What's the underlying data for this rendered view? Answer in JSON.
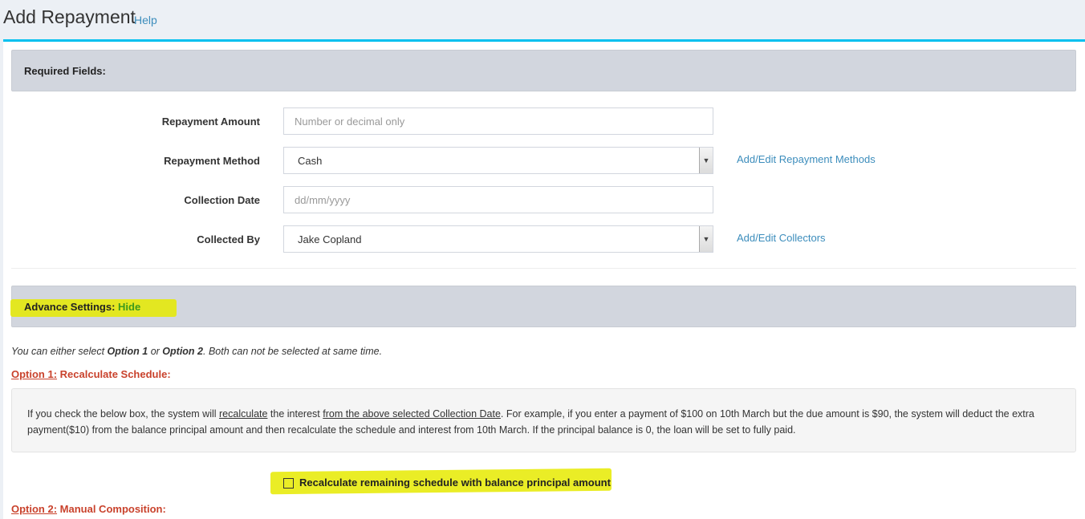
{
  "header": {
    "title": "Add Repayment",
    "help_label": "Help"
  },
  "required_section": {
    "title": "Required Fields:"
  },
  "form": {
    "repayment_amount": {
      "label": "Repayment Amount",
      "value": "",
      "placeholder": "Number or decimal only"
    },
    "repayment_method": {
      "label": "Repayment Method",
      "selected": "Cash",
      "link": "Add/Edit Repayment Methods"
    },
    "collection_date": {
      "label": "Collection Date",
      "value": "",
      "placeholder": "dd/mm/yyyy"
    },
    "collected_by": {
      "label": "Collected By",
      "selected": "Jake Copland",
      "link": "Add/Edit Collectors"
    }
  },
  "advance_section": {
    "title": "Advance Settings:",
    "toggle_label": "Hide"
  },
  "info": {
    "prefix": "You can either select ",
    "option1": "Option 1",
    "middle": " or ",
    "option2": "Option 2",
    "suffix": ". Both can not be selected at same time."
  },
  "option1": {
    "label": "Option 1:",
    "title": " Recalculate Schedule:",
    "desc_part1": "If you check the below box, the system will ",
    "desc_u1": "recalculate",
    "desc_part2": " the interest ",
    "desc_u2": "from the above selected Collection Date",
    "desc_part3": ". For example, if you enter a payment of $100 on 10th March but the due amount is $90, the system will deduct the extra payment($10) from the balance principal amount and then recalculate the schedule and interest from 10th March. If the principal balance is 0, the loan will be set to fully paid.",
    "checkbox_label": "Recalculate remaining schedule with balance principal amount",
    "checked": false
  },
  "option2": {
    "label": "Option 2:",
    "title": " Manual Composition:"
  },
  "colors": {
    "accent": "#00c0ef",
    "link": "#3c8dbc",
    "option_heading": "#c9422c",
    "hide_link": "#3c9a1c",
    "highlight": "#e6ea00"
  }
}
